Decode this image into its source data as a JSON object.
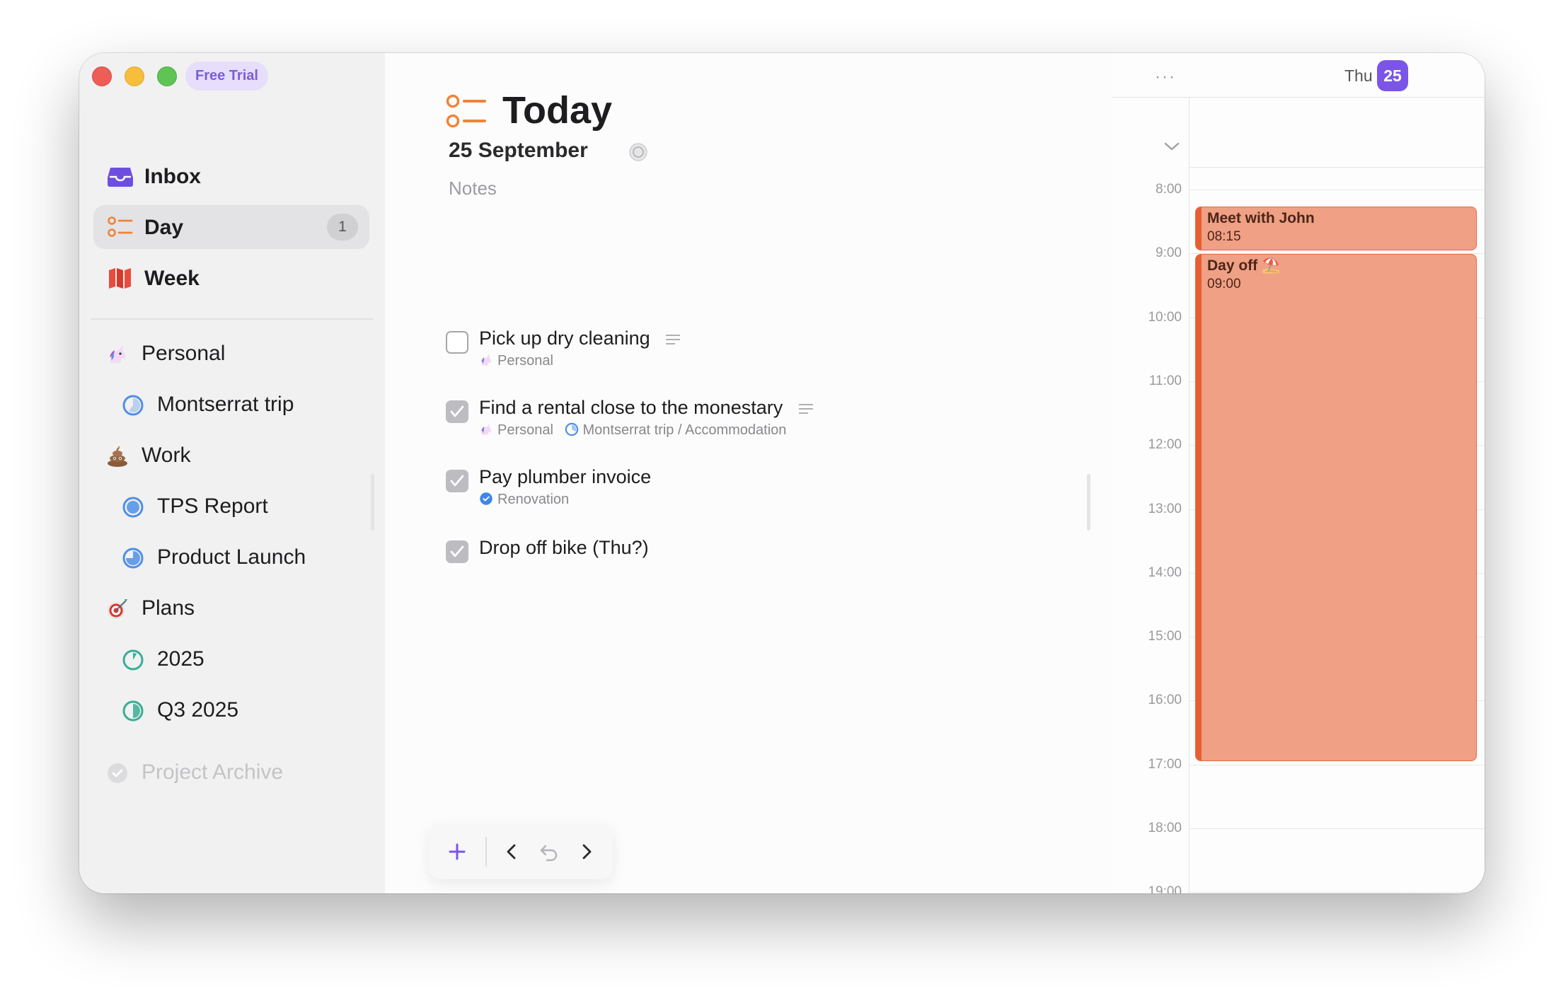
{
  "window": {
    "trial_badge": "Free Trial"
  },
  "sidebar": {
    "nav": [
      {
        "label": "Inbox",
        "icon": "inbox-icon"
      },
      {
        "label": "Day",
        "icon": "day-list-icon",
        "badge": "1",
        "active": true
      },
      {
        "label": "Week",
        "icon": "week-map-icon"
      }
    ],
    "projects": [
      {
        "label": "Personal",
        "icon": "unicorn-icon",
        "level": 0
      },
      {
        "label": "Montserrat trip",
        "icon": "progress-circle-icon",
        "level": 1
      },
      {
        "label": "Work",
        "icon": "poop-emoji-icon",
        "level": 0
      },
      {
        "label": "TPS Report",
        "icon": "progress-circle-icon",
        "level": 1
      },
      {
        "label": "Product Launch",
        "icon": "progress-circle-icon",
        "level": 1
      },
      {
        "label": "Plans",
        "icon": "target-icon",
        "level": 0
      },
      {
        "label": "2025",
        "icon": "progress-circle-icon",
        "level": 1
      },
      {
        "label": "Q3 2025",
        "icon": "progress-circle-icon",
        "level": 1
      }
    ],
    "archive_label": "Project Archive"
  },
  "main": {
    "title": "Today",
    "date": "25 September",
    "notes_placeholder": "Notes",
    "tasks": [
      {
        "title": "Pick up dry cleaning",
        "checked": false,
        "has_note": true,
        "meta": [
          {
            "icon": "unicorn-icon",
            "text": "Personal"
          }
        ]
      },
      {
        "title": "Find a rental close to the monestary",
        "checked": true,
        "has_note": true,
        "meta": [
          {
            "icon": "unicorn-icon",
            "text": "Personal"
          },
          {
            "icon": "progress-circle-icon",
            "text": "Montserrat trip / Accommodation"
          }
        ]
      },
      {
        "title": "Pay plumber invoice",
        "checked": true,
        "has_note": false,
        "meta": [
          {
            "icon": "check-circle-icon",
            "text": "Renovation"
          }
        ]
      },
      {
        "title": "Drop off bike (Thu?)",
        "checked": true,
        "has_note": false,
        "meta": []
      }
    ]
  },
  "calendar": {
    "day_name": "Thu",
    "day_number": "25",
    "hours": [
      "8:00",
      "9:00",
      "10:00",
      "11:00",
      "12:00",
      "13:00",
      "14:00",
      "15:00",
      "16:00",
      "17:00",
      "18:00",
      "19:00"
    ],
    "events": [
      {
        "title": "Meet with John",
        "time": "08:15"
      },
      {
        "title": "Day off ⛱️",
        "time": "09:00"
      }
    ],
    "accent_color": "#7a55e8",
    "event_color": "#f0a085"
  }
}
